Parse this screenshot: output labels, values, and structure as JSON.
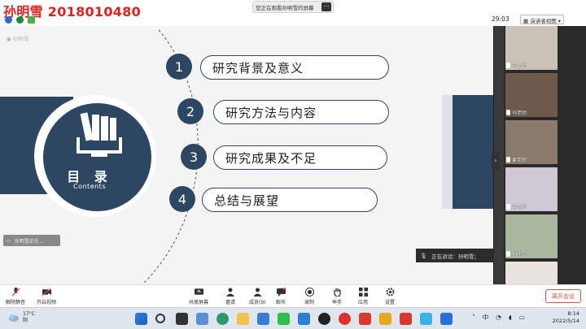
{
  "watermark": {
    "text": "孙明雪 2018010480"
  },
  "banner": {
    "text": "您正在观看孙明雪的屏幕",
    "more": "···"
  },
  "timer": "29:03",
  "view_mode": {
    "label": "演讲者视图",
    "arrow": "▾"
  },
  "slide": {
    "toc_title": "目 录",
    "toc_subtitle": "Contents",
    "items": [
      {
        "num": "1",
        "text": "研究背景及意义"
      },
      {
        "num": "2",
        "text": "研究方法与内容"
      },
      {
        "num": "3",
        "text": "研究成果及不足"
      },
      {
        "num": "4",
        "text": "总结与展望"
      }
    ],
    "speaker_mini": "孙明雪",
    "mini_left_text": "孙明雪正在..."
  },
  "speaking": {
    "label": "正在讲话：孙明雪；"
  },
  "gallery": [
    {
      "name": "向老师",
      "bg": "#c9c2b5"
    },
    {
      "name": "马老师",
      "bg": "#6d5a4a"
    },
    {
      "name": "黄老师",
      "bg": "#8a7a6a"
    },
    {
      "name": "梁老师",
      "bg": "#cfc8d4"
    },
    {
      "name": "孙明雪",
      "bg": "#a9b79f"
    },
    {
      "name": "",
      "bg": "#e9e4df"
    }
  ],
  "toolbar": {
    "mute": "解除静音",
    "video": "开启视频",
    "share": "共享屏幕",
    "invite": "邀请",
    "members": "成员(9)",
    "chat": "聊天",
    "record": "录制",
    "raise": "举手",
    "apps": "应用",
    "settings": "设置",
    "leave": "离开会议"
  },
  "taskbar": {
    "temp": "17°C",
    "weather": "阴",
    "ime": "中",
    "time": "8:14",
    "date": "2022/5/14"
  }
}
